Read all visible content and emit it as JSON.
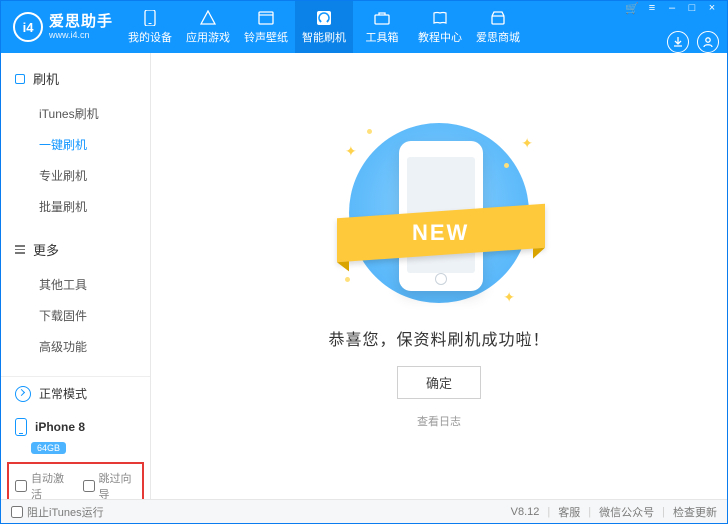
{
  "brand": {
    "name": "爱思助手",
    "url": "www.i4.cn",
    "logo_text": "i4"
  },
  "win": {
    "cart": "⌂",
    "menu": "≡",
    "min": "–",
    "max": "□",
    "close": "×"
  },
  "nav": [
    {
      "key": "devices",
      "label": "我的设备"
    },
    {
      "key": "apps",
      "label": "应用游戏"
    },
    {
      "key": "ringwall",
      "label": "铃声壁纸"
    },
    {
      "key": "flash",
      "label": "智能刷机",
      "active": true
    },
    {
      "key": "toolbox",
      "label": "工具箱"
    },
    {
      "key": "tutorial",
      "label": "教程中心"
    },
    {
      "key": "store",
      "label": "爱思商城"
    }
  ],
  "sidebar": {
    "group1": {
      "title": "刷机",
      "items": [
        "iTunes刷机",
        "一键刷机",
        "专业刷机",
        "批量刷机"
      ],
      "active_index": 1
    },
    "group2": {
      "title": "更多",
      "items": [
        "其他工具",
        "下载固件",
        "高级功能"
      ]
    },
    "mode": {
      "label": "正常模式"
    },
    "device": {
      "name": "iPhone 8",
      "storage": "64GB"
    },
    "options": {
      "auto_activate": "自动激活",
      "skip_guide": "跳过向导"
    }
  },
  "main": {
    "ribbon": "NEW",
    "success_text": "恭喜您，保资料刷机成功啦！",
    "ok": "确定",
    "view_log": "查看日志"
  },
  "footer": {
    "block_itunes": "阻止iTunes运行",
    "version": "V8.12",
    "support": "客服",
    "wechat": "微信公众号",
    "update": "检查更新"
  }
}
